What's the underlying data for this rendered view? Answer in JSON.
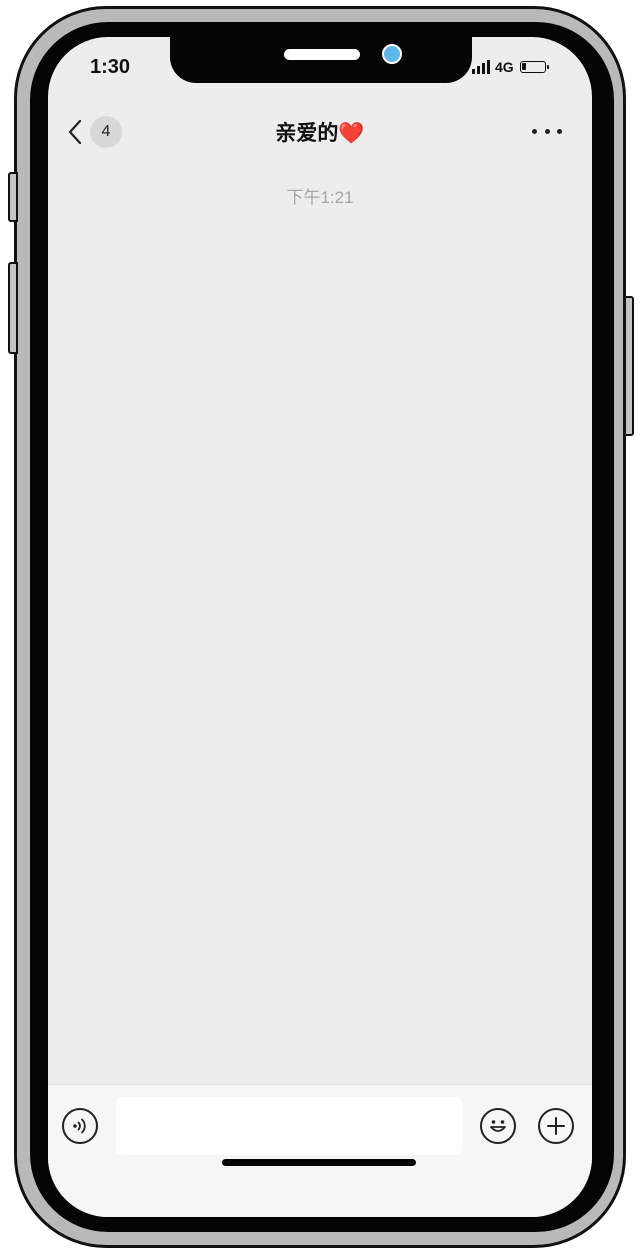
{
  "status_bar": {
    "time": "1:30",
    "network": "4G",
    "icons": [
      "signal-icon",
      "battery-icon"
    ]
  },
  "nav": {
    "back_icon": "chevron-left-icon",
    "unread_count": "4",
    "title": "亲爱的❤️",
    "more_icon": "more-dots-icon"
  },
  "chat": {
    "timestamp": "下午1:21"
  },
  "input_bar": {
    "voice_icon": "voice-icon",
    "message_value": "",
    "emoji_icon": "emoji-icon",
    "plus_icon": "plus-icon"
  },
  "colors": {
    "chat_background": "#ededed",
    "timestamp_text": "#a6a6a6",
    "camera_dot": "#5fb6e8",
    "phone_frame": "#b9b9b9"
  }
}
